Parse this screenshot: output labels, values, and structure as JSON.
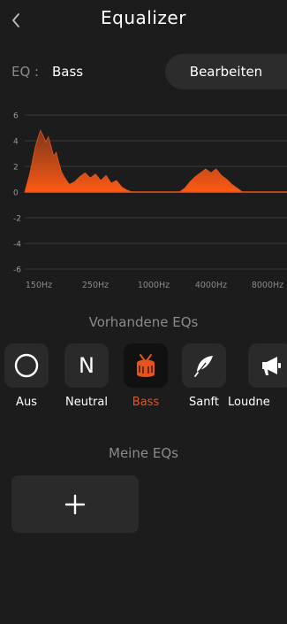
{
  "header": {
    "title": "Equalizer",
    "back_icon": "chevron-left-icon"
  },
  "eq_row": {
    "label": "EQ :",
    "current": "Bass",
    "edit_label": "Bearbeiten"
  },
  "chart_data": {
    "type": "area",
    "x_tick_labels": [
      "150Hz",
      "250Hz",
      "1000Hz",
      "4000Hz",
      "8000Hz"
    ],
    "y_ticks": [
      6,
      4,
      2,
      0,
      -2,
      -4,
      -6
    ],
    "ylim": [
      -6,
      6
    ],
    "x_range": [
      0,
      100
    ],
    "series": [
      {
        "color": "#e8531d",
        "x": [
          0,
          2,
          4,
          5,
          6,
          7,
          8,
          9,
          10,
          11,
          12,
          13,
          14,
          15,
          17,
          19,
          21,
          23,
          25,
          27,
          29,
          31,
          33,
          35,
          37,
          39,
          41,
          43,
          45,
          47,
          49,
          51,
          53,
          55,
          57,
          59,
          61,
          63,
          65,
          67,
          69,
          71,
          73,
          75,
          77,
          79,
          81,
          83,
          85,
          87,
          89,
          91,
          93,
          95,
          97,
          100
        ],
        "values": [
          0,
          1.5,
          3.5,
          4.2,
          4.8,
          4.4,
          3.9,
          4.3,
          3.6,
          2.8,
          3.1,
          2.3,
          1.6,
          1.2,
          0.6,
          0.8,
          1.2,
          1.5,
          1.1,
          1.4,
          0.9,
          1.3,
          0.7,
          0.9,
          0.4,
          0.15,
          0,
          0,
          0,
          0,
          0,
          0,
          0,
          0,
          0,
          0,
          0.3,
          0.8,
          1.2,
          1.5,
          1.8,
          1.5,
          1.8,
          1.3,
          1.0,
          0.6,
          0.3,
          0,
          0,
          0,
          0,
          0,
          0,
          0,
          0,
          0
        ]
      }
    ]
  },
  "presets_section": {
    "title": "Vorhandene EQs"
  },
  "presets": [
    {
      "label": "Aus",
      "icon": "circle-off-icon",
      "glyph": ""
    },
    {
      "label": "Neutral",
      "icon": "letter-n-icon",
      "glyph": "N"
    },
    {
      "label": "Bass",
      "icon": "drum-icon",
      "glyph": "",
      "active": true
    },
    {
      "label": "Sanft",
      "icon": "feather-icon",
      "glyph": ""
    },
    {
      "label": "Loudne",
      "icon": "megaphone-icon",
      "glyph": ""
    }
  ],
  "my_eqs": {
    "title": "Meine EQs",
    "add_icon": "plus-icon"
  },
  "colors": {
    "accent": "#e8531d",
    "background": "#1c1c1c",
    "tile": "#2a2a2a",
    "muted": "#8a8a8a"
  }
}
